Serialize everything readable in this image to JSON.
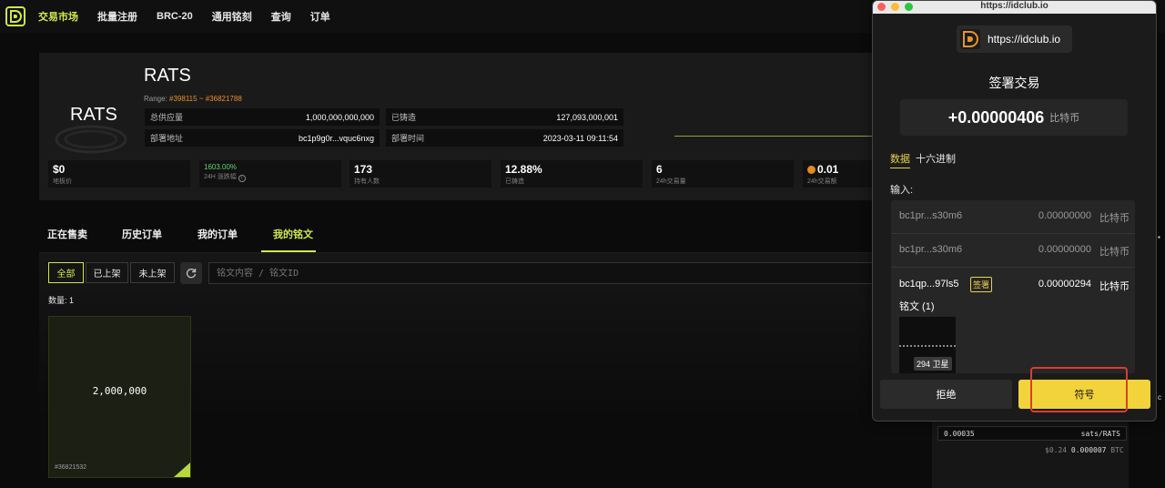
{
  "nav": {
    "items": [
      "交易市场",
      "批量注册",
      "BRC-20",
      "通用铭刻",
      "查询",
      "订单"
    ],
    "active_index": 0,
    "accent_color": "#cfe84a"
  },
  "token": {
    "image_label": "RATS",
    "name": "RATS",
    "range_prefix": "Range:",
    "range_from": "#398115",
    "range_sep": "~",
    "range_to": "#36821788",
    "total_supply_label": "总供应量",
    "total_supply": "1,000,000,000,000",
    "minted_label": "已铸造",
    "minted": "127,093,000,001",
    "deployer_label": "部署地址",
    "deployer": "bc1p9g0r...vquc6nxg",
    "deploy_time_label": "部署时间",
    "deploy_time": "2023-03-11 09:11:54"
  },
  "stats": [
    {
      "value": "$0",
      "label": "地板价"
    },
    {
      "value": "1603.00%",
      "label": "24H 涨跌幅"
    },
    {
      "value": "173",
      "label": "持有人数"
    },
    {
      "value": "12.88%",
      "label": "已铸造"
    },
    {
      "value": "6",
      "label": "24h交易量"
    },
    {
      "value": "0.01",
      "label": "24h交易额"
    }
  ],
  "tabs": [
    "正在售卖",
    "历史订单",
    "我的订单",
    "我的铭文"
  ],
  "active_tab": 3,
  "filters": {
    "segments": [
      "全部",
      "已上架",
      "未上架"
    ],
    "active": 0,
    "search_placeholder": "铭文内容 / 铭文ID",
    "count_label": "数量: 1"
  },
  "inscription_card": {
    "amount": "2,000,000",
    "id": "#36821532"
  },
  "right_panel": {
    "price_value": "0.00035",
    "price_unit": "sats/RATS",
    "usd": "$0.24",
    "btc_value": "0.000007",
    "btc_unit": "BTC"
  },
  "popup": {
    "window_title": "https://idclub.io",
    "site": "https://idclub.io",
    "title": "签署交易",
    "amount": "+0.00000406",
    "amount_unit": "比特币",
    "tabs": [
      "数据",
      "十六进制"
    ],
    "active_tab": 0,
    "inputs_label": "输入:",
    "inputs": [
      {
        "address": "bc1pr...s30m6",
        "amount": "0.00000000",
        "unit": "比特币"
      },
      {
        "address": "bc1pr...s30m6",
        "amount": "0.00000000",
        "unit": "比特币"
      },
      {
        "address": "bc1qp...97ls5",
        "amount": "0.00000294",
        "unit": "比特币",
        "tag": "签署"
      }
    ],
    "inscriptions_label": "铭文 (1)",
    "inscription_badge": "294 卫星",
    "reject_label": "拒绝",
    "sign_label": "符号",
    "highlight_color": "#e03b2f",
    "sign_color": "#f2d33b"
  }
}
